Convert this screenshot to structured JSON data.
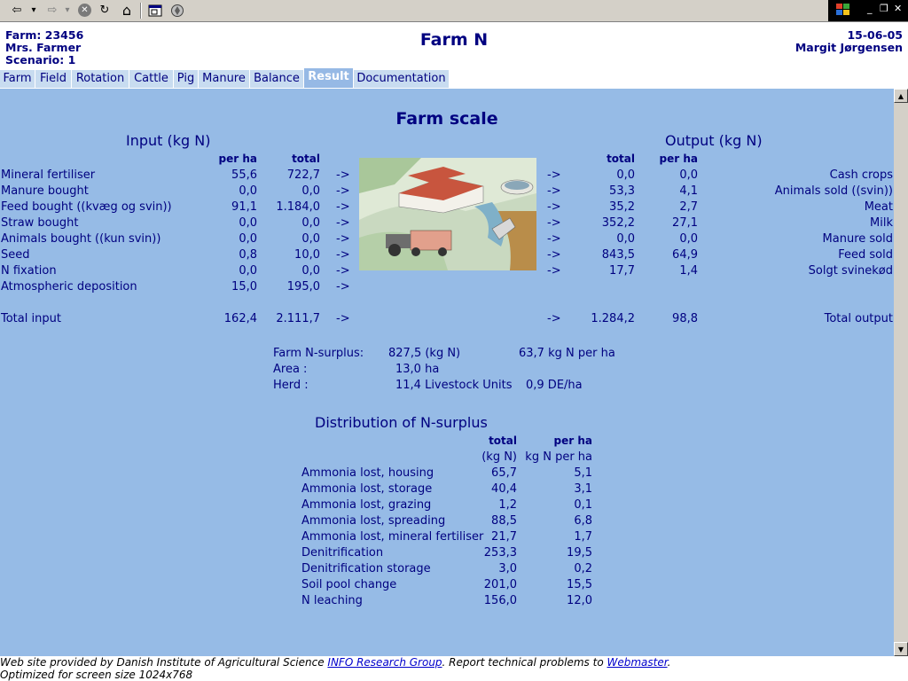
{
  "toolbar": {
    "back_glyph": "⇦",
    "forward_glyph": "⇨",
    "dropdown_glyph": "▾",
    "stop_glyph": "✕",
    "refresh_glyph": "↻",
    "home_glyph": "⌂",
    "window_min": "_",
    "window_max": "❐",
    "window_close": "✕"
  },
  "header": {
    "farm": "Farm: 23456",
    "farmer": "Mrs. Farmer",
    "scenario": "Scenario: 1",
    "title": "Farm N",
    "date": "15-06-05",
    "user": "Margit Jørgensen"
  },
  "tabs": [
    "Farm",
    "Field",
    "Rotation",
    "Cattle",
    "Pig",
    "Manure",
    "Balance",
    "Result",
    "Documentation"
  ],
  "active_tab": "Result",
  "section_title": "Farm scale",
  "input": {
    "heading": "Input (kg N)",
    "col_per_ha": "per ha",
    "col_total": "total",
    "arrow": "->",
    "rows": [
      {
        "label": "Mineral fertiliser",
        "per_ha": "55,6",
        "total": "722,7"
      },
      {
        "label": "Manure bought",
        "per_ha": "0,0",
        "total": "0,0"
      },
      {
        "label": "Feed bought ((kvæg og svin))",
        "per_ha": "91,1",
        "total": "1.184,0"
      },
      {
        "label": "Straw bought",
        "per_ha": "0,0",
        "total": "0,0"
      },
      {
        "label": "Animals bought ((kun svin))",
        "per_ha": "0,0",
        "total": "0,0"
      },
      {
        "label": "Seed",
        "per_ha": "0,8",
        "total": "10,0"
      },
      {
        "label": "N fixation",
        "per_ha": "0,0",
        "total": "0,0"
      },
      {
        "label": "Atmospheric deposition",
        "per_ha": "15,0",
        "total": "195,0"
      }
    ],
    "total": {
      "label": "Total input",
      "per_ha": "162,4",
      "total": "2.111,7"
    }
  },
  "output": {
    "heading": "Output (kg N)",
    "col_total": "total",
    "col_per_ha": "per ha",
    "arrow": "->",
    "rows": [
      {
        "label": "Cash crops",
        "total": "0,0",
        "per_ha": "0,0"
      },
      {
        "label": "Animals sold ((svin))",
        "total": "53,3",
        "per_ha": "4,1"
      },
      {
        "label": "Meat",
        "total": "35,2",
        "per_ha": "2,7"
      },
      {
        "label": "Milk",
        "total": "352,2",
        "per_ha": "27,1"
      },
      {
        "label": "Manure sold",
        "total": "0,0",
        "per_ha": "0,0"
      },
      {
        "label": "Feed sold",
        "total": "843,5",
        "per_ha": "64,9"
      },
      {
        "label": "Solgt svinekød",
        "total": "17,7",
        "per_ha": "1,4"
      }
    ],
    "total": {
      "label": "Total output",
      "total": "1.284,2",
      "per_ha": "98,8"
    }
  },
  "summary": {
    "surplus_label": "Farm N-surplus:",
    "surplus_value": "827,5 (kg N)",
    "surplus_per_ha": "63,7 kg N per ha",
    "area_label": "Area :",
    "area_value": "13,0 ha",
    "herd_label": "Herd :",
    "herd_value": "11,4 Livestock Units",
    "herd_per_ha": "0,9 DE/ha"
  },
  "distribution": {
    "heading": "Distribution of N-surplus",
    "col_total": "total",
    "col_per_ha": "per ha",
    "col_total_unit": "(kg N)",
    "col_per_ha_unit": "kg N per ha",
    "rows": [
      {
        "label": "Ammonia lost, housing",
        "total": "65,7",
        "per_ha": "5,1"
      },
      {
        "label": "Ammonia lost, storage",
        "total": "40,4",
        "per_ha": "3,1"
      },
      {
        "label": "Ammonia lost, grazing",
        "total": "1,2",
        "per_ha": "0,1"
      },
      {
        "label": "Ammonia lost, spreading",
        "total": "88,5",
        "per_ha": "6,8"
      },
      {
        "label": "Ammonia lost, mineral fertiliser",
        "total": "21,7",
        "per_ha": "1,7"
      },
      {
        "label": "Denitrification",
        "total": "253,3",
        "per_ha": "19,5"
      },
      {
        "label": "Denitrification storage",
        "total": "3,0",
        "per_ha": "0,2"
      },
      {
        "label": "Soil pool change",
        "total": "201,0",
        "per_ha": "15,5"
      },
      {
        "label": "N leaching",
        "total": "156,0",
        "per_ha": "12,0"
      }
    ]
  },
  "footer": {
    "text1": "Web site provided by Danish Institute of Agricultural Science ",
    "link1": "INFO Research Group",
    "text2": ". Report technical problems to ",
    "link2": "Webmaster",
    "text3": ".",
    "line2": "Optimized for screen size 1024x768"
  }
}
